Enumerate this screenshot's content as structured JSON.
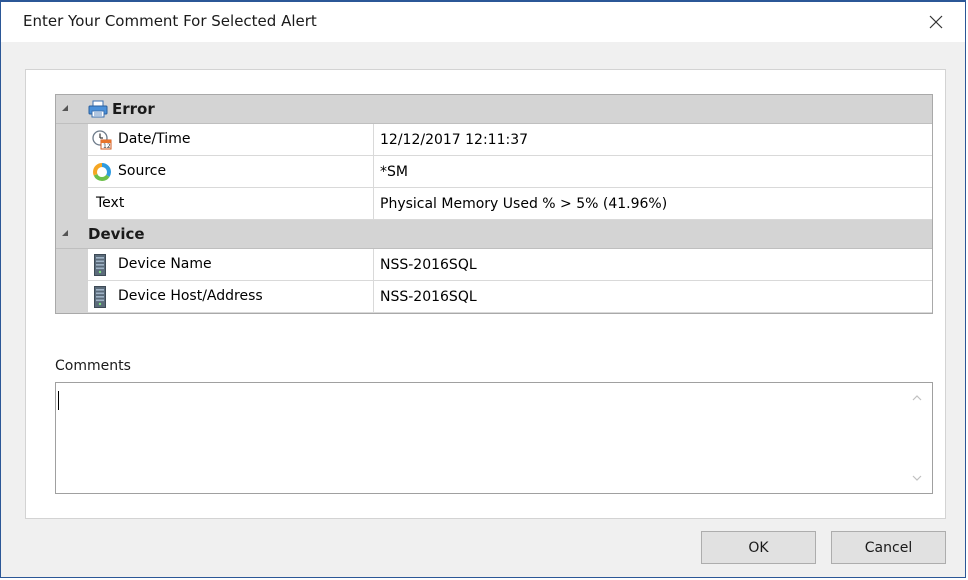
{
  "window": {
    "title": "Enter Your Comment For Selected Alert"
  },
  "grid": {
    "categories": [
      {
        "label": "Error",
        "icon": "printer-icon",
        "rows": [
          {
            "name": "Date/Time",
            "value": "12/12/2017 12:11:37",
            "icon": "clock-calendar-icon"
          },
          {
            "name": "Source",
            "value": "*SM",
            "icon": "source-ring-icon"
          },
          {
            "name": "Text",
            "value": "Physical Memory Used %  > 5% (41.96%)",
            "icon": ""
          }
        ]
      },
      {
        "label": "Device",
        "icon": "",
        "rows": [
          {
            "name": "Device Name",
            "value": "NSS-2016SQL",
            "icon": "server-icon"
          },
          {
            "name": "Device Host/Address",
            "value": "NSS-2016SQL",
            "icon": "server-icon"
          }
        ]
      }
    ]
  },
  "comments": {
    "label": "Comments",
    "value": ""
  },
  "buttons": {
    "ok": "OK",
    "cancel": "Cancel"
  }
}
